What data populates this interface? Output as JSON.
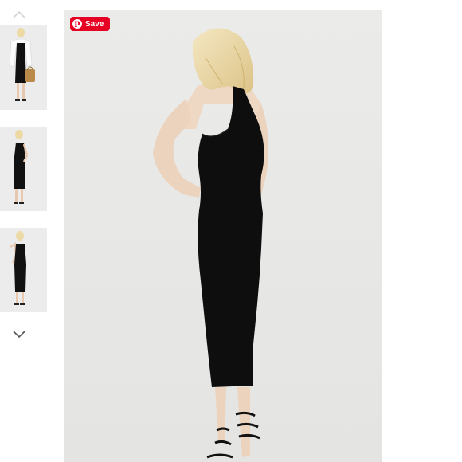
{
  "gallery": {
    "save_button": {
      "label": "Save",
      "icon": "pinterest-icon",
      "color": "#e60023"
    },
    "nav": {
      "up_icon": "chevron-up-icon",
      "down_icon": "chevron-down-icon"
    },
    "thumbnails": [
      {
        "view": "front-with-jacket-and-bag"
      },
      {
        "view": "side"
      },
      {
        "view": "back"
      }
    ],
    "main_image": {
      "view": "back"
    }
  }
}
